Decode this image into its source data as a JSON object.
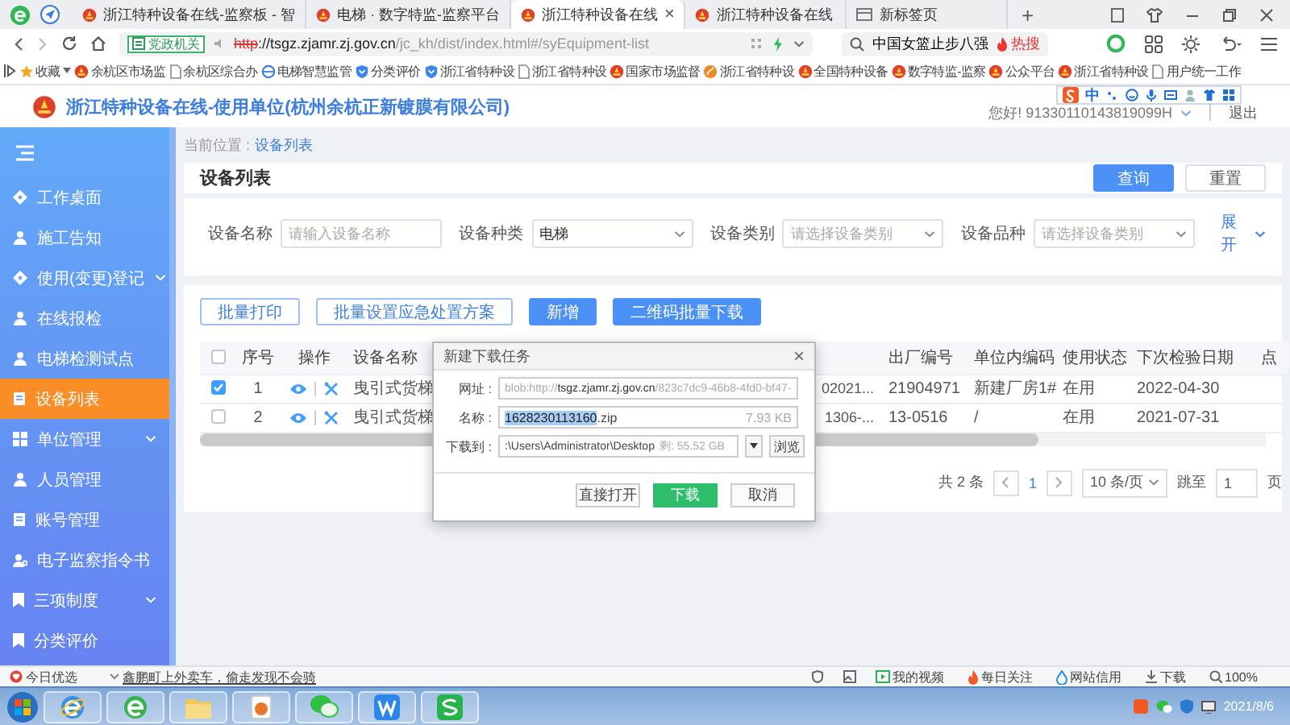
{
  "browser": {
    "tabs": [
      {
        "title": "浙江特种设备在线-监察板 - 智",
        "kind": "site",
        "selected": false
      },
      {
        "title": "电梯 · 数字特监-监察平台",
        "kind": "site",
        "selected": false
      },
      {
        "title": "浙江特种设备在线",
        "kind": "site",
        "selected": true,
        "close": "×"
      },
      {
        "title": "浙江特种设备在线",
        "kind": "site",
        "selected": false
      },
      {
        "title": "新标签页",
        "kind": "blank",
        "selected": false
      }
    ],
    "new_tab": "+",
    "address": {
      "badge": "党政机关",
      "scheme": "http",
      "host": "://tsgz.zjamr.zj.gov.cn",
      "path": "/jc_kh/dist/index.html#/syEquipment-list"
    },
    "search": {
      "value": "中国女篮止步八强",
      "hot": "热搜"
    },
    "favorites": "收藏",
    "bookmarks": [
      {
        "label": "余杭区市场监",
        "kind": "emblem"
      },
      {
        "label": "余杭区综合办",
        "kind": "page"
      },
      {
        "label": "电梯智慧监管",
        "kind": "globe"
      },
      {
        "label": "分类评价",
        "kind": "shield"
      },
      {
        "label": "浙江省特种设",
        "kind": "shield"
      },
      {
        "label": "浙江省特种设",
        "kind": "page"
      },
      {
        "label": "国家市场监督",
        "kind": "emblem"
      },
      {
        "label": "浙江省特种设",
        "kind": "swirl"
      },
      {
        "label": "全国特种设备",
        "kind": "emblem"
      },
      {
        "label": "数字特监-监察",
        "kind": "emblem"
      },
      {
        "label": "公众平台",
        "kind": "emblem"
      },
      {
        "label": "浙江省特种设",
        "kind": "emblem"
      },
      {
        "label": "用户统一工作",
        "kind": "page"
      }
    ]
  },
  "page_header": {
    "title": "浙江特种设备在线-使用单位(杭州余杭正新镀膜有限公司)",
    "greeting": "您好! 91330110143819099H",
    "logout": "退出"
  },
  "ime_toolbar": {
    "mode": "中"
  },
  "sidebar": {
    "items": [
      {
        "label": "工作桌面",
        "kind": "link",
        "selected": false
      },
      {
        "label": "施工告知",
        "kind": "link",
        "selected": false
      },
      {
        "label": "使用(变更)登记",
        "kind": "group",
        "selected": false
      },
      {
        "label": "在线报检",
        "kind": "link",
        "selected": false
      },
      {
        "label": "电梯检测试点",
        "kind": "link",
        "selected": false
      },
      {
        "label": "设备列表",
        "kind": "link",
        "selected": true
      },
      {
        "label": "单位管理",
        "kind": "group",
        "selected": false
      },
      {
        "label": "人员管理",
        "kind": "link",
        "selected": false
      },
      {
        "label": "账号管理",
        "kind": "link",
        "selected": false
      },
      {
        "label": "电子监察指令书",
        "kind": "link",
        "selected": false
      },
      {
        "label": "三项制度",
        "kind": "group",
        "selected": false
      },
      {
        "label": "分类评价",
        "kind": "link",
        "selected": false
      }
    ]
  },
  "breadcrumb": {
    "label": "当前位置 :",
    "current": "设备列表"
  },
  "search_panel": {
    "title": "设备列表",
    "buttons": [
      {
        "label": "查询",
        "kind": "primary"
      },
      {
        "label": "重置",
        "kind": "default"
      }
    ],
    "filters": [
      {
        "label": "设备名称",
        "kind": "input",
        "placeholder": "请输入设备名称"
      },
      {
        "label": "设备种类",
        "kind": "select",
        "value": "电梯"
      },
      {
        "label": "设备类别",
        "kind": "select",
        "placeholder": "请选择设备类别"
      },
      {
        "label": "设备品种",
        "kind": "select",
        "placeholder": "请选择设备类别"
      }
    ],
    "expand": "展开"
  },
  "action_buttons": [
    {
      "label": "批量打印",
      "kind": "outline"
    },
    {
      "label": "批量设置应急处置方案",
      "kind": "outline"
    },
    {
      "label": "新增",
      "kind": "primary"
    },
    {
      "label": "二维码批量下载",
      "kind": "primary"
    }
  ],
  "table": {
    "select_all": {
      "checked": false
    },
    "columns": [
      "序号",
      "操作",
      "设备名称",
      "出厂编号",
      "单位内编码",
      "使用状态",
      "下次检验日期",
      "点"
    ],
    "rows": [
      {
        "checked": true,
        "index": "1",
        "name": "曳引式货梯",
        "column_5": "02021...",
        "factory_no": "21904971",
        "unit_code": "新建厂房1#",
        "status": "在用",
        "next_inspection": "2022-04-30"
      },
      {
        "checked": false,
        "index": "2",
        "name": "曳引式货梯",
        "column_5": "1306-...",
        "factory_no": "13-0516",
        "unit_code": "/",
        "status": "在用",
        "next_inspection": "2021-07-31"
      }
    ]
  },
  "pagination": {
    "total": "共 2 条",
    "pages": [
      {
        "label": "1",
        "selected": true
      }
    ],
    "page_size": "10 条/页",
    "jump_label": "跳至",
    "jump_value": "1",
    "suffix": "页"
  },
  "download_dialog": {
    "title": "新建下载任务",
    "close": "×",
    "url": {
      "label": "网址 :",
      "parts": [
        {
          "text": "blob:http://",
          "kind": "muted"
        },
        {
          "text": "tsgz.zjamr.zj.gov.cn",
          "kind": "host"
        },
        {
          "text": "/823c7dc9-46b8-4fd0-bf47-",
          "kind": "muted"
        }
      ]
    },
    "name": {
      "label": "名称 :",
      "selected_text": "1628230113160",
      "rest": ".zip",
      "size": "7.93 KB"
    },
    "path": {
      "label": "下载到 :",
      "value": ":\\Users\\Administrator\\Desktop",
      "free": "剩: 55.52 GB",
      "browse": "浏览"
    },
    "buttons": [
      {
        "label": "直接打开",
        "kind": "default"
      },
      {
        "label": "下载",
        "kind": "primary"
      },
      {
        "label": "取消",
        "kind": "default"
      }
    ]
  },
  "status_bar": {
    "left": [
      {
        "label": "今日优选",
        "kind": "heart"
      },
      {
        "label": "鑫鹏町上外卖车，偷走发现不会骑",
        "kind": "news"
      }
    ],
    "right": [
      {
        "label": "我的视频",
        "kind": "video"
      },
      {
        "label": "每日关注",
        "kind": "fire"
      },
      {
        "label": "网站信用",
        "kind": "drop"
      },
      {
        "label": "下载",
        "kind": "download"
      },
      {
        "label": "100%",
        "kind": "zoom"
      }
    ]
  },
  "taskbar": {
    "apps": [
      {
        "kind": "ie"
      },
      {
        "kind": "green"
      },
      {
        "kind": "folder"
      },
      {
        "kind": "media"
      },
      {
        "kind": "chat"
      },
      {
        "kind": "writer"
      },
      {
        "kind": "sheet"
      }
    ],
    "date": "2021/8/6"
  }
}
